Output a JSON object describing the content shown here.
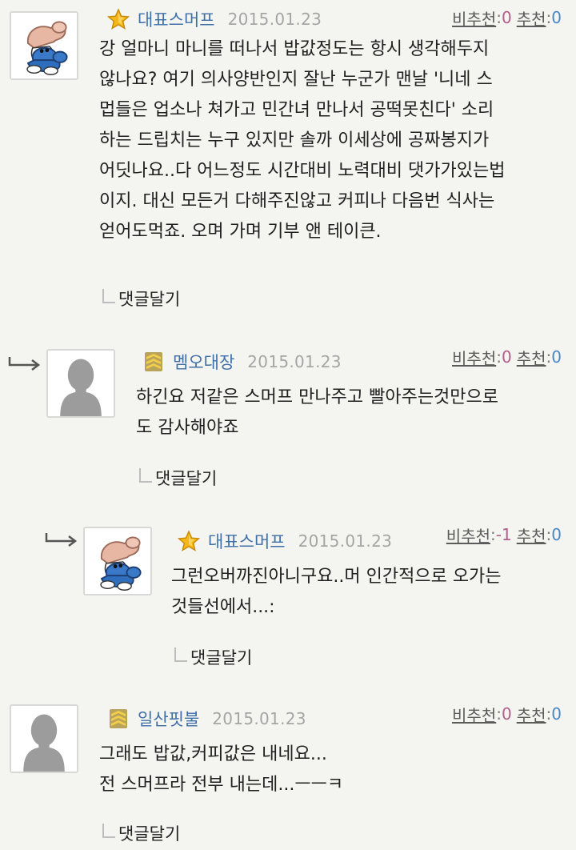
{
  "comments": [
    {
      "nick": "대표스머프",
      "date": "2015.01.23",
      "down_label": "비추천",
      "down_count": "0",
      "up_label": "추천",
      "up_count": "0",
      "body": "강 얼마니 마니를 떠나서 밥값정도는 항시 생각해두지\n않나요? 여기 의사양반인지 잘난 누군가 맨날 '니네 스\n멉들은 업소나 쳐가고 민간녀 만나서 공떡못친다' 소리\n하는 드립치는 누구 있지만 솔까 이세상에 공짜봉지가\n어딧나요..다 어느정도 시간대비 노력대비 댓가가있는법\n이지. 대신 모든거 다해주진않고 커피나 다음번 식사는\n얻어도먹죠. 오며 가며 기부 앤 테이큰.",
      "reply_label": "댓글달기",
      "badge": "star-badge-icon",
      "avatar": "smurf-avatar"
    },
    {
      "nick": "멤오대장",
      "date": "2015.01.23",
      "down_label": "비추천",
      "down_count": "0",
      "up_label": "추천",
      "up_count": "0",
      "body": "하긴요 저같은 스머프 만나주고 빨아주는것만으로\n도 감사해야죠",
      "reply_label": "댓글달기",
      "badge": "rank-stripes-icon",
      "avatar": "default-avatar"
    },
    {
      "nick": "대표스머프",
      "date": "2015.01.23",
      "down_label": "비추천",
      "down_count": "-1",
      "up_label": "추천",
      "up_count": "0",
      "body": "그런오버까진아니구요..머 인간적으로 오가는\n것들선에서...:",
      "reply_label": "댓글달기",
      "badge": "star-badge-icon",
      "avatar": "smurf-avatar"
    },
    {
      "nick": "일산핏불",
      "date": "2015.01.23",
      "down_label": "비추천",
      "down_count": "0",
      "up_label": "추천",
      "up_count": "0",
      "body": "그래도 밥값,커피값은 내네요...\n전 스머프라 전부 내는데...ㅡㅡㅋ",
      "reply_label": "댓글달기",
      "badge": "rank-stripes-icon",
      "avatar": "default-avatar"
    }
  ],
  "colors": {
    "background": "#f4f4f0",
    "nick": "#3f6fa8",
    "date": "#a5a5a5",
    "down_count": "#b25e8d",
    "up_count": "#4b87c5"
  }
}
